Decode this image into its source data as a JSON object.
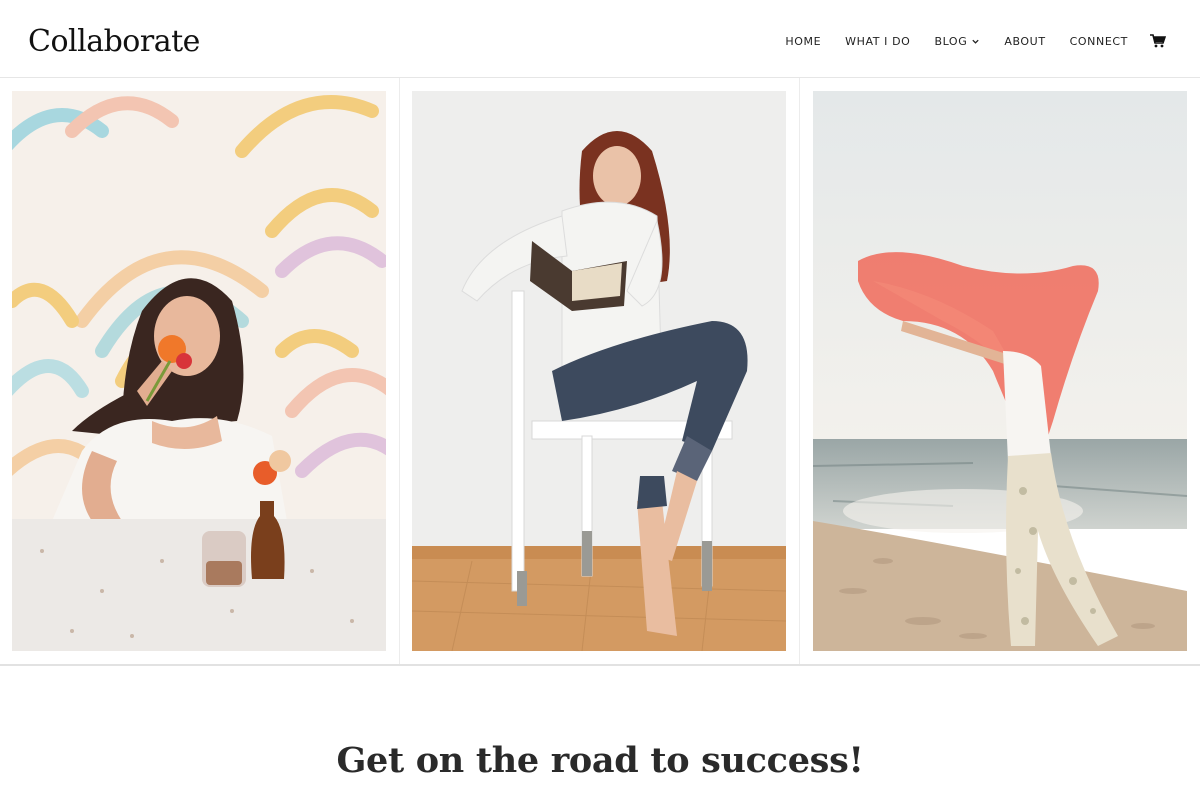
{
  "brand": {
    "name": "Collaborate"
  },
  "nav": {
    "items": [
      {
        "label": "HOME"
      },
      {
        "label": "WHAT I DO"
      },
      {
        "label": "BLOG"
      },
      {
        "label": "ABOUT"
      },
      {
        "label": "CONNECT"
      }
    ],
    "cart_icon": "cart-icon"
  },
  "gallery": {
    "images": [
      {
        "subject": "woman-with-flowers-rainbow-wall"
      },
      {
        "subject": "woman-reading-on-chair"
      },
      {
        "subject": "woman-with-scarf-on-beach"
      }
    ]
  },
  "hero": {
    "heading": "Get on the road to success!"
  }
}
